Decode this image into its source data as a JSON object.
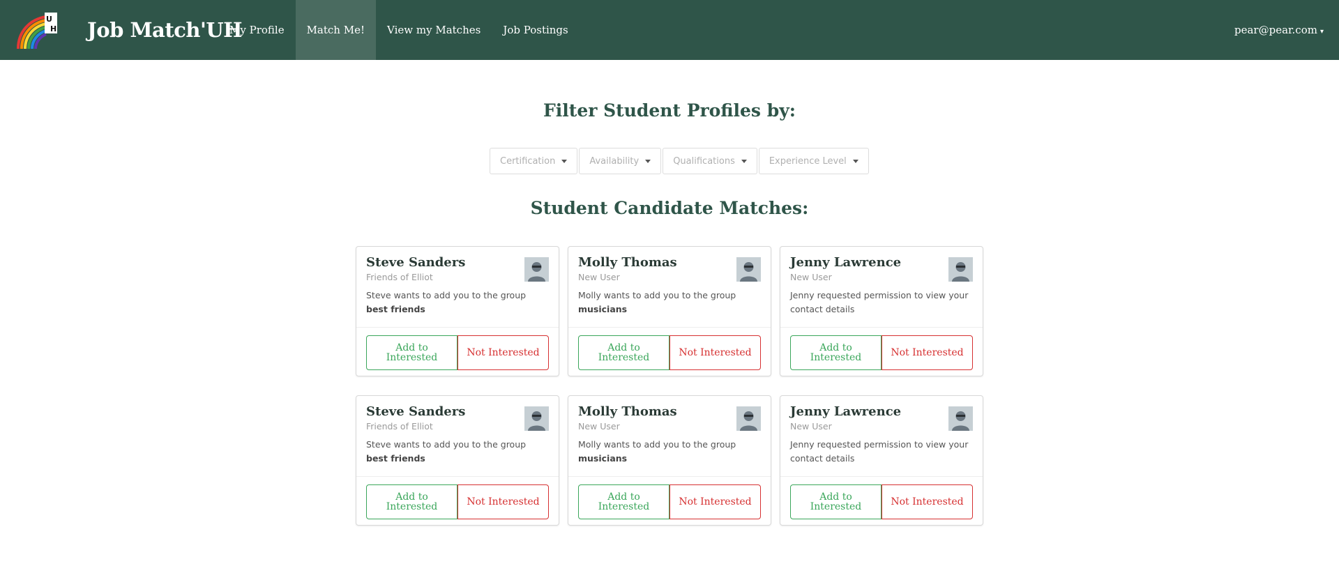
{
  "header": {
    "brand": "Job Match'UH",
    "logo_name": "uh-rainbow-logo",
    "nav": [
      {
        "label": "My Profile",
        "active": false
      },
      {
        "label": "Match Me!",
        "active": true
      },
      {
        "label": "View my Matches",
        "active": false
      },
      {
        "label": "Job Postings",
        "active": false
      }
    ],
    "user": "pear@pear.com",
    "user_caret": "▾"
  },
  "filters": {
    "title": "Filter Student Profiles by:",
    "options": [
      "Certification",
      "Availability",
      "Qualifications",
      "Experience Level"
    ]
  },
  "matches": {
    "title": "Student Candidate Matches:",
    "cards": [
      {
        "name": "Steve Sanders",
        "meta": "Friends of Elliot",
        "desc_text": "Steve wants to add you to the group ",
        "desc_bold": "best friends",
        "add_label": "Add to Interested",
        "not_label": "Not Interested"
      },
      {
        "name": "Molly Thomas",
        "meta": "New User",
        "desc_text": "Molly wants to add you to the group ",
        "desc_bold": "musicians",
        "add_label": "Add to Interested",
        "not_label": "Not Interested"
      },
      {
        "name": "Jenny Lawrence",
        "meta": "New User",
        "desc_text": "Jenny requested permission to view your contact details",
        "desc_bold": "",
        "add_label": "Add to Interested",
        "not_label": "Not Interested"
      },
      {
        "name": "Steve Sanders",
        "meta": "Friends of Elliot",
        "desc_text": "Steve wants to add you to the group ",
        "desc_bold": "best friends",
        "add_label": "Add to Interested",
        "not_label": "Not Interested"
      },
      {
        "name": "Molly Thomas",
        "meta": "New User",
        "desc_text": "Molly wants to add you to the group ",
        "desc_bold": "musicians",
        "add_label": "Add to Interested",
        "not_label": "Not Interested"
      },
      {
        "name": "Jenny Lawrence",
        "meta": "New User",
        "desc_text": "Jenny requested permission to view your contact details",
        "desc_bold": "",
        "add_label": "Add to Interested",
        "not_label": "Not Interested"
      }
    ]
  },
  "colors": {
    "navbar": "#2f5549",
    "nav_active": "#4a6b60",
    "title": "#2f5549",
    "add_green": "#3aa65a",
    "not_red": "#d63031"
  }
}
